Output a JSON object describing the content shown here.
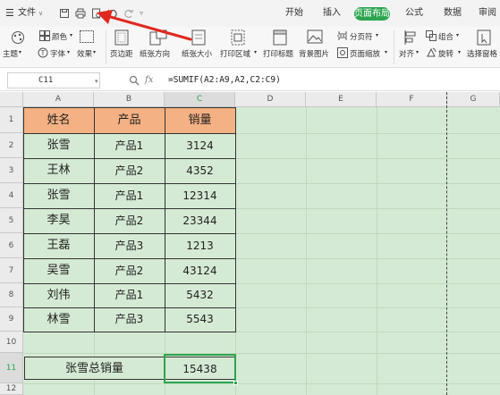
{
  "topbar": {
    "menu_label": "文件",
    "tabs": [
      "开始",
      "插入",
      "页面布局",
      "公式",
      "数据",
      "审阅"
    ],
    "active_tab": "页面布局"
  },
  "ribbon": {
    "items": {
      "colors": "颜色",
      "theme": "主题",
      "fonts": "字体",
      "effects": "效果",
      "margins": "页边距",
      "orientation": "纸张方向",
      "size": "纸张大小",
      "print_area": "打印区域",
      "print_titles": "打印标题",
      "background": "背景图片",
      "breaks": "分页符",
      "page_zoom": "页面缩放",
      "group": "组合",
      "align": "对齐",
      "rotate": "旋转",
      "selection_pane": "选择窗格"
    }
  },
  "formula_bar": {
    "cell_ref": "C11",
    "fx": "fx",
    "formula": "=SUMIF(A2:A9,A2,C2:C9)"
  },
  "grid": {
    "columns": [
      "A",
      "B",
      "C",
      "D",
      "E",
      "F",
      "G"
    ],
    "rows": [
      "1",
      "2",
      "3",
      "4",
      "5",
      "6",
      "7",
      "8",
      "9",
      "10",
      "11",
      "12"
    ],
    "header": [
      "姓名",
      "产品",
      "销量"
    ],
    "data": [
      [
        "张雪",
        "产品1",
        "3124"
      ],
      [
        "王林",
        "产品2",
        "4352"
      ],
      [
        "张雪",
        "产品1",
        "12314"
      ],
      [
        "李昊",
        "产品2",
        "23344"
      ],
      [
        "王磊",
        "产品3",
        "1213"
      ],
      [
        "吴雪",
        "产品2",
        "43124"
      ],
      [
        "刘伟",
        "产品1",
        "5432"
      ],
      [
        "林雪",
        "产品3",
        "5543"
      ]
    ],
    "summary_label": "张雪总销量",
    "summary_value": "15438"
  },
  "colors": {
    "header_fill": "#f4b183",
    "grid_green": "#d5ead4",
    "accent_green": "#2ca54e",
    "arrow_red": "#e0281e"
  }
}
